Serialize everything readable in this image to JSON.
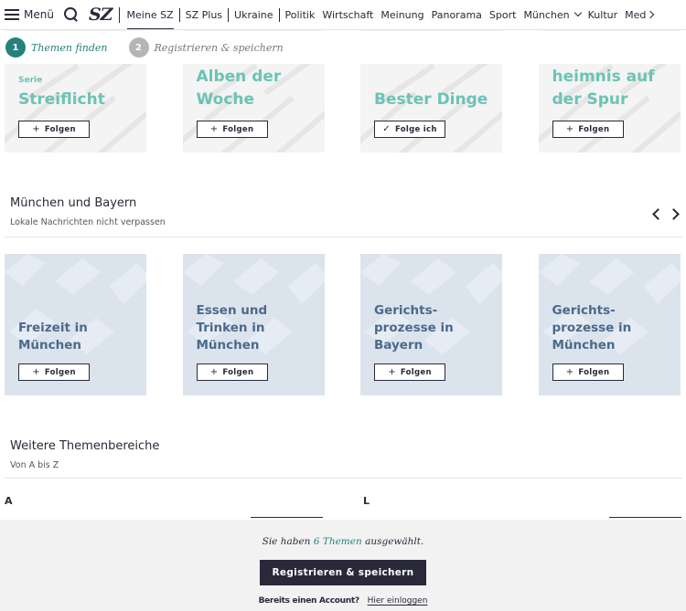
{
  "nav": {
    "menu_label": "Menü",
    "logo": "SZ",
    "items": [
      "Meine SZ",
      "SZ Plus",
      "Ukraine",
      "Politik",
      "Wirtschaft",
      "Meinung",
      "Panorama",
      "Sport",
      "München",
      "Kultur",
      "Med"
    ],
    "active_item": "Meine SZ"
  },
  "steps": [
    {
      "num": "1",
      "label": "Themen finden",
      "state": "active"
    },
    {
      "num": "2",
      "label": "Registrieren & speichern",
      "state": "inactive"
    }
  ],
  "top_cards": [
    {
      "kicker": "Serie",
      "title": "Streiflicht",
      "button": "Folgen",
      "button_icon": "plus-icon"
    },
    {
      "kicker": "",
      "title": "Alben der Woche",
      "button": "Folgen",
      "button_icon": "plus-icon"
    },
    {
      "kicker": "",
      "title": "Bester Dinge",
      "button": "Folge ich",
      "button_icon": "check-icon"
    },
    {
      "kicker": "",
      "title": "heimnis auf der Spur",
      "button": "Folgen",
      "button_icon": "plus-icon"
    }
  ],
  "muenchen_section": {
    "title": "München und Bayern",
    "subtitle": "Lokale Nachrichten nicht verpassen"
  },
  "muenchen_cards": [
    {
      "title": "Freizeit in München",
      "button": "Folgen"
    },
    {
      "title": "Essen und Trinken in München",
      "button": "Folgen"
    },
    {
      "title": "Gerichts-prozesse in Bayern",
      "button": "Folgen"
    },
    {
      "title": "Gerichts-prozesse in München",
      "button": "Folgen"
    }
  ],
  "weitere_section": {
    "title": "Weitere Themenbereiche",
    "subtitle": "Von A bis Z",
    "letters": [
      "A",
      "L"
    ]
  },
  "bottom": {
    "msg_prefix": "Sie haben",
    "msg_count": "6 Themen",
    "msg_suffix": "ausgewählt.",
    "register_button": "Registrieren & speichern",
    "account_question": "Bereits einen Account?",
    "login_link": "Hier einloggen"
  },
  "colors": {
    "accent_teal": "#25827a",
    "card_title_teal": "#6cc3b6",
    "card_blue_bg": "#dbe3ed",
    "card_blue_text": "#4b6a8b",
    "dark": "#29293a"
  }
}
